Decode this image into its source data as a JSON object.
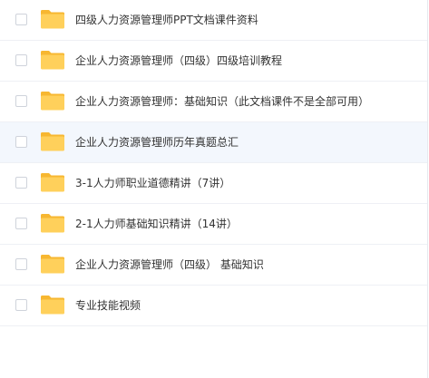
{
  "file_list": {
    "items": [
      {
        "name": "四级人力资源管理师PPT文档课件资料",
        "type": "folder",
        "selected": false
      },
      {
        "name": "企业人力资源管理师（四级）四级培训教程",
        "type": "folder",
        "selected": false
      },
      {
        "name": "企业人力资源管理师：基础知识（此文档课件不是全部可用）",
        "type": "folder",
        "selected": false
      },
      {
        "name": "企业人力资源管理师历年真题总汇",
        "type": "folder",
        "selected": false,
        "hovered": true
      },
      {
        "name": "3-1人力师职业道德精讲（7讲）",
        "type": "folder",
        "selected": false
      },
      {
        "name": "2-1人力师基础知识精讲（14讲）",
        "type": "folder",
        "selected": false
      },
      {
        "name": "企业人力资源管理师（四级） 基础知识",
        "type": "folder",
        "selected": false
      },
      {
        "name": "专业技能视频",
        "type": "folder",
        "selected": false
      }
    ]
  },
  "colors": {
    "folder_body": "#ffd05b",
    "folder_back": "#f7b731",
    "row_hover": "#f3f7fd",
    "divider": "#eef0f5"
  },
  "icons": {
    "folder": "folder-icon",
    "checkbox": "checkbox-icon"
  }
}
